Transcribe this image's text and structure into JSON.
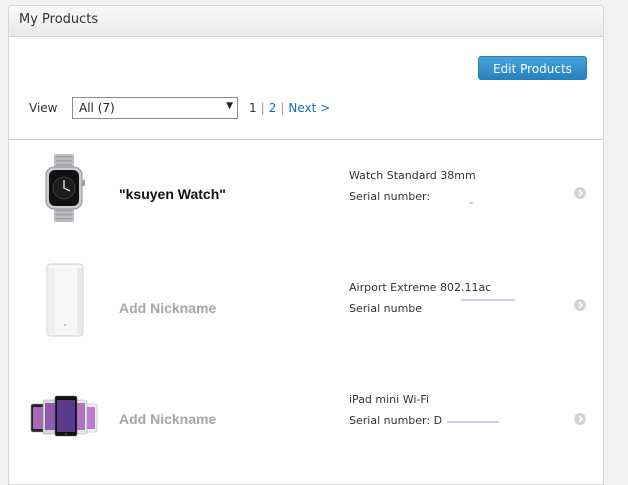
{
  "panel": {
    "title": "My Products"
  },
  "toolbar": {
    "edit_label": "Edit Products",
    "view_label": "View",
    "view_selected": "All (7)"
  },
  "pager": {
    "page1": "1",
    "page2": "2",
    "next": "Next >"
  },
  "products": [
    {
      "nickname": "\"ksuyen Watch\"",
      "model": "Watch Standard 38mm",
      "serial_label": "Serial number:",
      "icon": "apple-watch-icon"
    },
    {
      "nickname": "Add Nickname",
      "model": "Airport Extreme 802.11ac",
      "serial_label": "Serial numbe",
      "icon": "airport-extreme-icon"
    },
    {
      "nickname": "Add Nickname",
      "model": "iPad mini Wi-Fi",
      "serial_label": "Serial number: D",
      "icon": "ipad-mini-icon"
    }
  ],
  "colors": {
    "accent": "#2581c0",
    "link": "#0a72b8",
    "placeholder_nickname": "#a6a6a6"
  }
}
